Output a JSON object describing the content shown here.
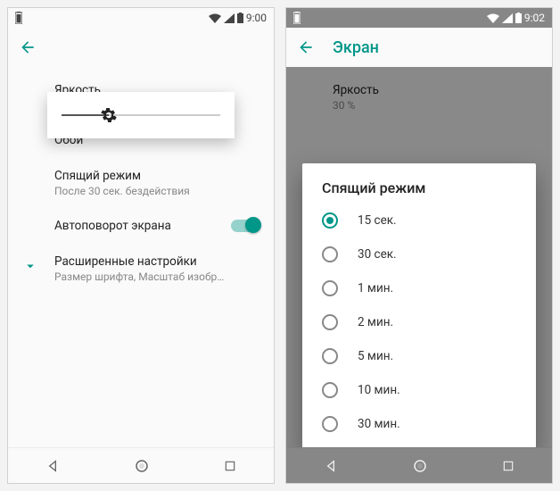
{
  "left": {
    "status": {
      "time": "9:00"
    },
    "items": {
      "brightness": {
        "title": "Яркость",
        "value": "30 %"
      },
      "wallpaper": {
        "title": "Обои"
      },
      "sleep": {
        "title": "Спящий режим",
        "value": "После 30 сек. бездействия"
      },
      "autorotate": {
        "title": "Автоповорот экрана"
      },
      "advanced": {
        "title": "Расширенные настройки",
        "value": "Размер шрифта, Масштаб изображения на экра.."
      }
    }
  },
  "right": {
    "status": {
      "time": "9:02"
    },
    "appbar": {
      "title": "Экран"
    },
    "items": {
      "brightness": {
        "title": "Яркость",
        "value": "30 %"
      }
    },
    "dialog": {
      "title": "Спящий режим",
      "options": [
        {
          "label": "15 сек.",
          "selected": true
        },
        {
          "label": "30 сек.",
          "selected": false
        },
        {
          "label": "1 мин.",
          "selected": false
        },
        {
          "label": "2 мин.",
          "selected": false
        },
        {
          "label": "5 мин.",
          "selected": false
        },
        {
          "label": "10 мин.",
          "selected": false
        },
        {
          "label": "30 мин.",
          "selected": false
        }
      ]
    }
  }
}
